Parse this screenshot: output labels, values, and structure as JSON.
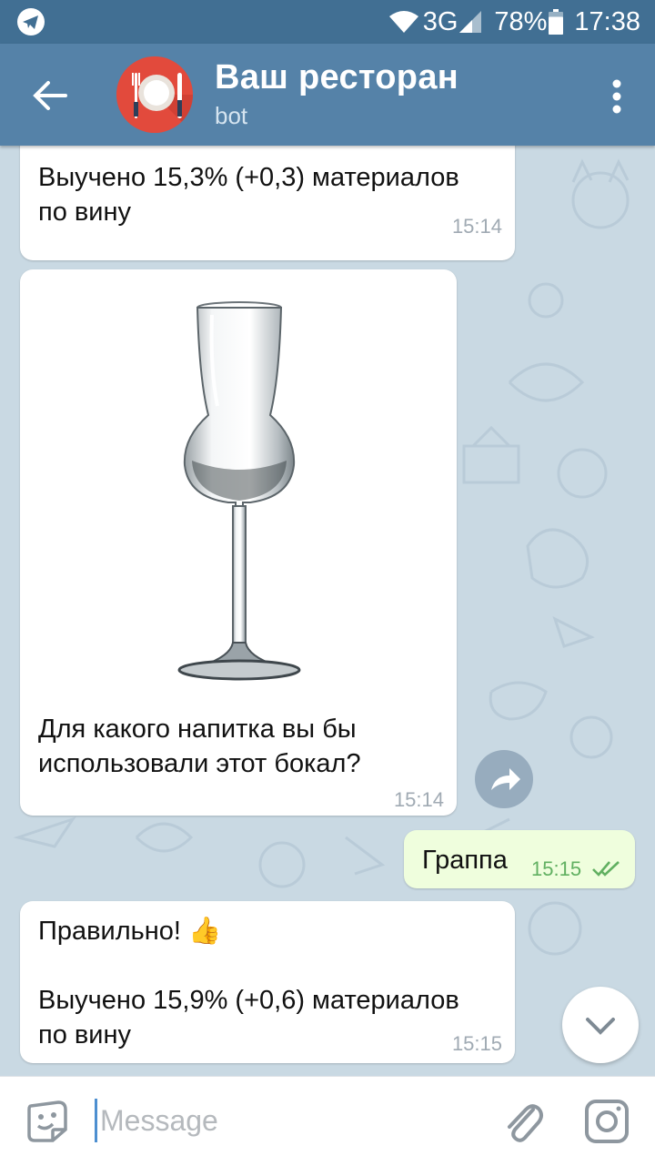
{
  "status_bar": {
    "network": "3G",
    "battery": "78%",
    "time": "17:38",
    "icons": [
      "telegram-icon",
      "wifi-icon",
      "signal-icon",
      "battery-icon"
    ]
  },
  "header": {
    "title": "Ваш ресторан",
    "subtitle": "bot",
    "icons": [
      "back-arrow-icon",
      "restaurant-avatar",
      "more-vertical-icon"
    ],
    "colors": {
      "bar": "#5582a8",
      "status_bar": "#416f93",
      "avatar": "#e24a3c"
    }
  },
  "messages": [
    {
      "direction": "in",
      "text": "Выучено 15,3% (+0,3) материалов\nпо вину",
      "time": "15:14"
    },
    {
      "direction": "in",
      "image": "grappa-glass",
      "text": "Для какого напитка вы бы\nиспользовали этот бокал?",
      "time": "15:14"
    },
    {
      "direction": "out",
      "text": "Граппа",
      "time": "15:15",
      "status": "read"
    },
    {
      "direction": "in",
      "text": "Правильно! 👍\n\nВыучено 15,9% (+0,6) материалов\nпо вину",
      "time": "15:15"
    }
  ],
  "composer": {
    "placeholder": "Message",
    "icons": [
      "sticker-icon",
      "attach-icon",
      "camera-icon"
    ]
  },
  "floating": {
    "icons": [
      "forward-icon",
      "scroll-down-icon"
    ]
  },
  "colors": {
    "outgoing_bubble": "#effedd",
    "incoming_bubble": "#ffffff",
    "read_checks": "#61b061",
    "chat_background": "#c9d9e3"
  }
}
